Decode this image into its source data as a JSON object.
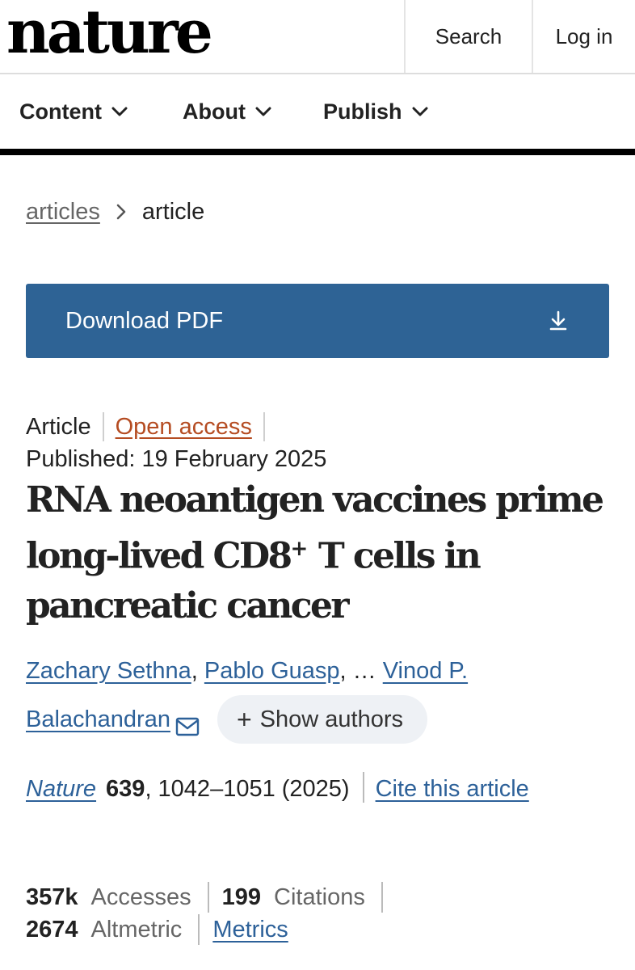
{
  "header": {
    "logo": "nature",
    "search_label": "Search",
    "login_label": "Log in"
  },
  "nav": {
    "items": [
      {
        "label": "Content"
      },
      {
        "label": "About"
      },
      {
        "label": "Publish"
      }
    ]
  },
  "breadcrumb": {
    "parent": "articles",
    "current": "article"
  },
  "download": {
    "label": "Download PDF"
  },
  "article": {
    "type": "Article",
    "access": "Open access",
    "published": "Published: 19 February 2025",
    "title_part1": "RNA neoantigen vaccines prime long-lived CD8",
    "title_sup": "+",
    "title_part2": " T cells in pancreatic cancer",
    "authors": [
      "Zachary Sethna",
      "Pablo Guasp",
      "Vinod P. Balachandran"
    ],
    "author_sep": ",",
    "ellipsis": "…",
    "show_authors": "Show authors",
    "journal": "Nature",
    "volume": "639",
    "pages_year": ", 1042–1051 (2025)",
    "cite_label": "Cite this article"
  },
  "metrics": {
    "accesses_value": "357k",
    "accesses_label": "Accesses",
    "citations_value": "199",
    "citations_label": "Citations",
    "altmetric_value": "2674",
    "altmetric_label": "Altmetric",
    "metrics_link": "Metrics"
  },
  "colors": {
    "download_button": "#2e6395",
    "link": "#2d6199",
    "open_access": "#b54c22"
  }
}
